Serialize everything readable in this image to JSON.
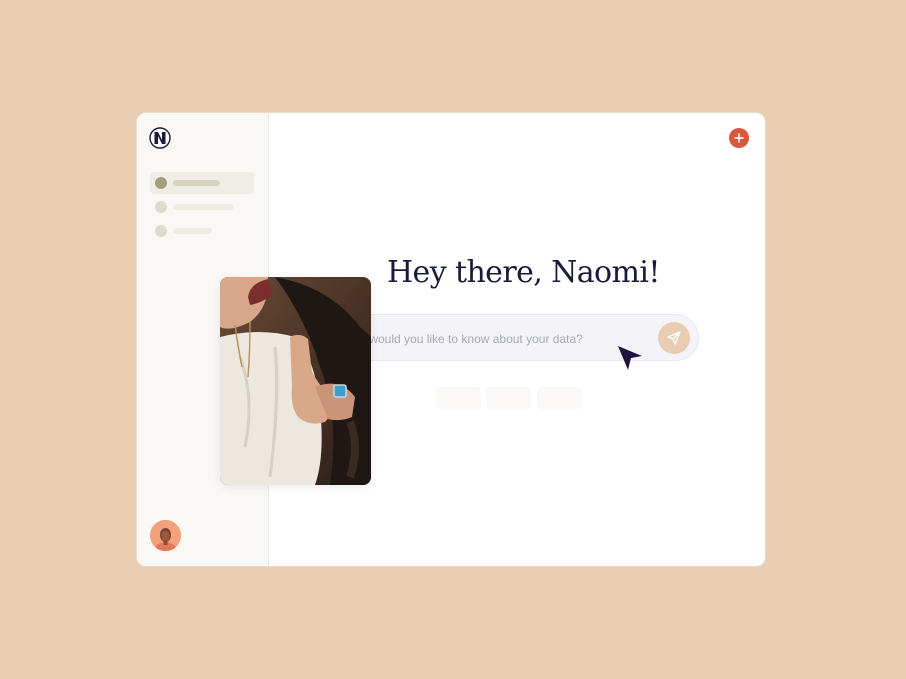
{
  "main": {
    "greeting": "Hey there, Naomi!",
    "search_placeholder": "What would you like to know about your data?"
  },
  "icons": {
    "logo": "n-logo-icon",
    "add": "plus-icon",
    "send": "send-icon",
    "cursor": "cursor-arrow-icon"
  },
  "colors": {
    "background": "#e8cdb3",
    "accent": "#d9583d",
    "text": "#1a1a3a",
    "send_button": "#e8cdb3"
  }
}
